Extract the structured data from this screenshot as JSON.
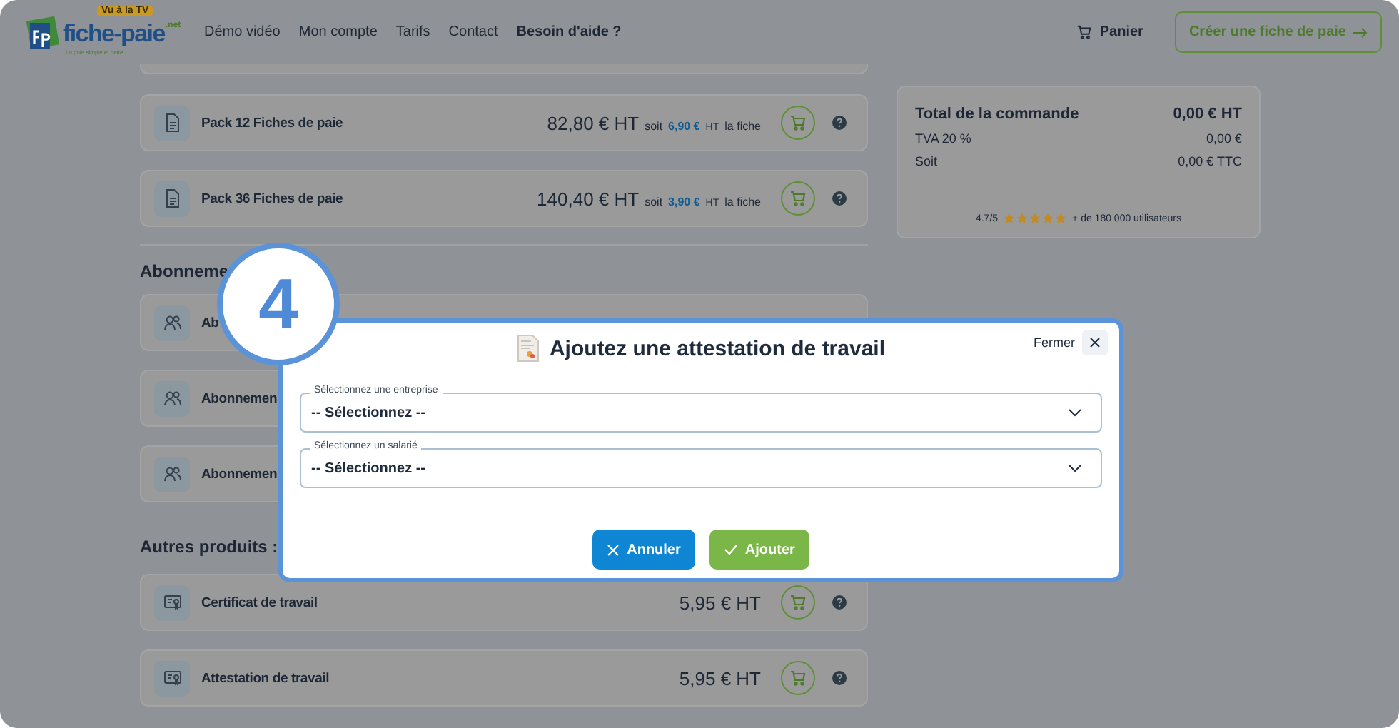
{
  "header": {
    "logo": {
      "badge": "Vu à la TV",
      "name": "fiche-paie",
      "suffix": ".net",
      "tagline": "La paie simple et nette"
    },
    "nav": [
      {
        "label": "Démo vidéo",
        "bold": false
      },
      {
        "label": "Mon compte",
        "bold": false
      },
      {
        "label": "Tarifs",
        "bold": false
      },
      {
        "label": "Contact",
        "bold": false
      },
      {
        "label": "Besoin d'aide ?",
        "bold": true
      }
    ],
    "cart": "Panier",
    "cta": "Créer une fiche de paie"
  },
  "packs": [
    {
      "name": "Pack 12 Fiches de paie",
      "price": "82,80 € HT",
      "prefix": "soit",
      "unit_price": "6,90 €",
      "unit_tax": "HT",
      "unit_note": "la fiche"
    },
    {
      "name": "Pack 36 Fiches de paie",
      "price": "140,40 € HT",
      "prefix": "soit",
      "unit_price": "3,90 €",
      "unit_tax": "HT",
      "unit_note": "la fiche"
    }
  ],
  "subscriptions": {
    "title": "Abonneme",
    "items": [
      {
        "name": "Ab"
      },
      {
        "name": "Abonnemen"
      },
      {
        "name": "Abonnemen"
      }
    ]
  },
  "others": {
    "title": "Autres produits :",
    "items": [
      {
        "name": "Certificat de travail",
        "price": "5,95 € HT"
      },
      {
        "name": "Attestation de travail",
        "price": "5,95 € HT"
      }
    ]
  },
  "summary": {
    "rows": [
      {
        "label": "Total de la commande",
        "value": "0,00 € HT",
        "bold": true
      },
      {
        "label": "TVA 20 %",
        "value": "0,00 €",
        "bold": false
      },
      {
        "label": "Soit",
        "value": "0,00 € TTC",
        "bold": false
      }
    ],
    "rating": {
      "score": "4.7/5",
      "stars": 5,
      "users": "+ de 180 000 utilisateurs"
    }
  },
  "step": "4",
  "modal": {
    "title": "Ajoutez une attestation de travail",
    "close_label": "Fermer",
    "fields": [
      {
        "label": "Sélectionnez une entreprise",
        "value": "-- Sélectionnez --"
      },
      {
        "label": "Sélectionnez un salarié",
        "value": "-- Sélectionnez --"
      }
    ],
    "buttons": [
      {
        "label": "Annuler",
        "kind": "cancel"
      },
      {
        "label": "Ajouter",
        "kind": "confirm"
      }
    ]
  }
}
